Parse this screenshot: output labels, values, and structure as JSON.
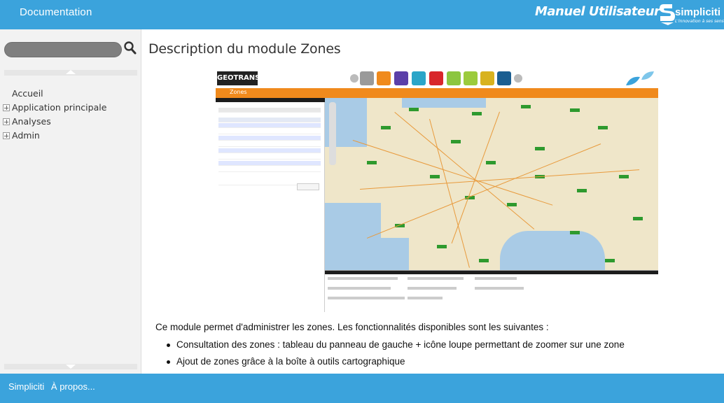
{
  "header": {
    "title": "Documentation",
    "manual_title": "Manuel Utilisateur",
    "logo_text": "simpliciti",
    "logo_tagline": "L'innovation à ses sens"
  },
  "sidebar": {
    "search": {
      "placeholder": "",
      "value": ""
    },
    "items": [
      {
        "label": "Accueil",
        "expandable": false
      },
      {
        "label": "Application principale",
        "expandable": true
      },
      {
        "label": "Analyses",
        "expandable": true
      },
      {
        "label": "Admin",
        "expandable": true
      }
    ]
  },
  "content": {
    "title": "Description du module Zones",
    "intro": "Ce module permet d'administrer les zones. Les fonctionnalités disponibles sont les suivantes :",
    "bullets": [
      "Consultation des zones : tableau du panneau de gauche + icône loupe permettant de zoomer sur une zone",
      "Ajout de zones grâce à la boîte à outils cartographique"
    ],
    "screenshot": {
      "logo": "GEOTRANS",
      "module_label": "Zones"
    }
  },
  "footer": {
    "links": [
      "Simpliciti",
      "À propos..."
    ]
  },
  "colors": {
    "primary": "#3ba3dc",
    "sidebar_bg": "#f2f2f2",
    "orange": "#f08a1c"
  }
}
